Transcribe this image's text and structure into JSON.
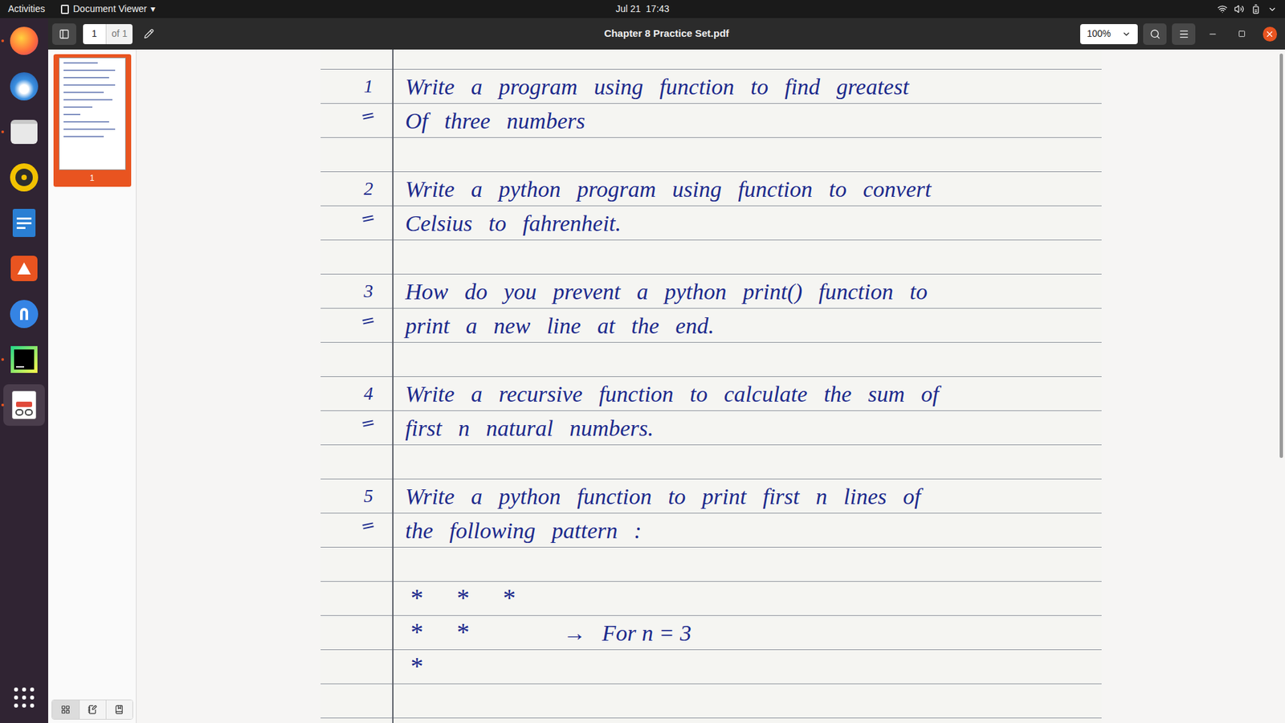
{
  "topbar": {
    "activities": "Activities",
    "app_menu": "Document Viewer",
    "app_menu_caret": "▾",
    "clock": "Jul 21  17:43"
  },
  "dock": [
    {
      "kind": "firefox",
      "running": true,
      "selected": false
    },
    {
      "kind": "thunderbird",
      "running": false,
      "selected": false
    },
    {
      "kind": "files",
      "running": true,
      "selected": false
    },
    {
      "kind": "rhythmbox",
      "running": false,
      "selected": false
    },
    {
      "kind": "writer",
      "running": false,
      "selected": false
    },
    {
      "kind": "software",
      "running": false,
      "selected": false
    },
    {
      "kind": "help",
      "running": false,
      "selected": false
    },
    {
      "kind": "pycharm",
      "running": true,
      "selected": false
    },
    {
      "kind": "viewer",
      "running": true,
      "selected": true
    }
  ],
  "window": {
    "title": "Chapter 8 Practice Set.pdf",
    "page_entry": "1",
    "page_count": "of 1",
    "zoom": "100%",
    "sidebar_open": true
  },
  "sidebar": {
    "thumbnails": [
      {
        "label": "1",
        "selected": true
      }
    ],
    "tabs": [
      {
        "kind": "thumbnails",
        "selected": true
      },
      {
        "kind": "annotations",
        "selected": false
      },
      {
        "kind": "bookmarks",
        "selected": false
      }
    ]
  },
  "document": {
    "scrollbar": {
      "level": 0.6
    },
    "questions": [
      {
        "number": "1",
        "lines": [
          "Write a program using function to find greatest",
          "Of three numbers"
        ]
      },
      {
        "number": "2",
        "lines": [
          "Write a python program using function to convert",
          "Celsius to fahrenheit."
        ]
      },
      {
        "number": "3",
        "lines": [
          "How do you prevent a python print() function to",
          "print a new line at the end."
        ]
      },
      {
        "number": "4",
        "lines": [
          "Write a recursive function to calculate the sum of",
          "first n natural numbers."
        ]
      },
      {
        "number": "5",
        "lines": [
          "Write a python function to print first n lines of",
          "the following pattern :"
        ]
      }
    ],
    "pattern": {
      "rows": [
        [
          "*",
          "*",
          "*"
        ],
        [
          "*",
          "*"
        ],
        [
          "*"
        ]
      ],
      "arrow": "→",
      "note": "For n = 3"
    }
  }
}
